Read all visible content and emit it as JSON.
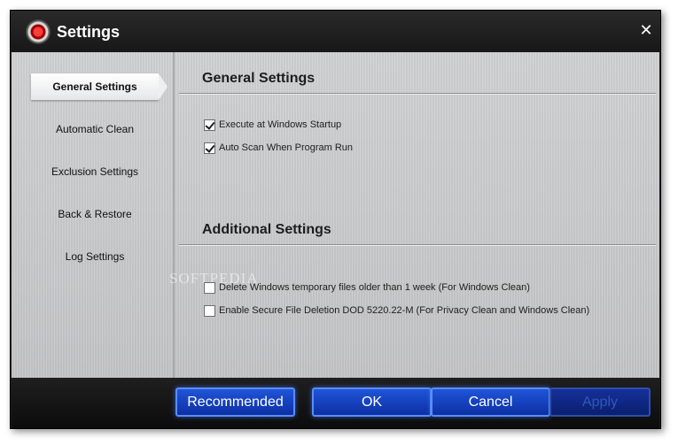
{
  "window": {
    "title": "Settings",
    "close_glyph": "✕",
    "icons": {
      "logo": "app-logo-icon",
      "close": "close-icon"
    },
    "accent": "#1a44c8"
  },
  "sidebar": {
    "items": [
      {
        "label": "General Settings",
        "active": true
      },
      {
        "label": "Automatic Clean",
        "active": false
      },
      {
        "label": "Exclusion Settings",
        "active": false
      },
      {
        "label": "Back & Restore",
        "active": false
      },
      {
        "label": "Log Settings",
        "active": false
      }
    ]
  },
  "general": {
    "title": "General Settings",
    "options": [
      {
        "label": "Execute at Windows Startup",
        "checked": true
      },
      {
        "label": "Auto Scan When Program Run",
        "checked": true
      }
    ]
  },
  "additional": {
    "title": "Additional Settings",
    "options": [
      {
        "label": "Delete Windows temporary files older than 1 week (For Windows Clean)",
        "checked": false
      },
      {
        "label": "Enable Secure File Deletion DOD 5220.22-M (For Privacy Clean and Windows Clean)",
        "checked": false
      }
    ]
  },
  "watermark": "SOFTPEDIA",
  "footer": {
    "recommended": "Recommended",
    "ok": "OK",
    "cancel": "Cancel",
    "apply": "Apply",
    "apply_enabled": false
  }
}
